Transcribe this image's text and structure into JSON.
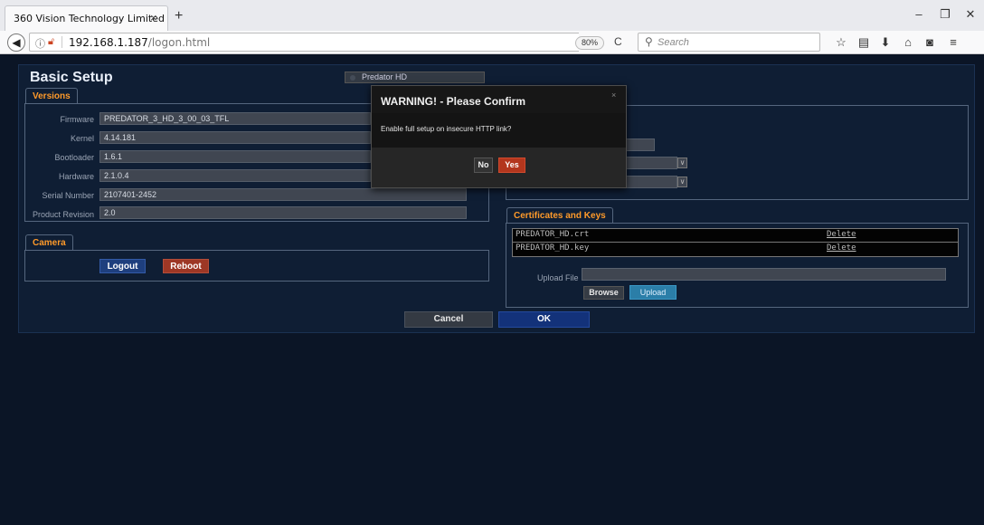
{
  "browser": {
    "tab_title": "360 Vision Technology Limited",
    "tab_close": "×",
    "new_tab": "+",
    "minimize": "–",
    "maximize": "❐",
    "close": "✕",
    "back_icon": "◀",
    "url_host": "192.168.1.187",
    "url_path": "/logon.html",
    "zoom": "80%",
    "reload_icon": "C",
    "search_placeholder": "Search"
  },
  "page": {
    "title": "Basic Setup",
    "device_name": "Predator HD"
  },
  "versions": {
    "tab_label": "Versions",
    "rows": [
      {
        "label": "Firmware",
        "value": "PREDATOR_3_HD_3_00_03_TFL"
      },
      {
        "label": "Kernel",
        "value": "4.14.181"
      },
      {
        "label": "Bootloader",
        "value": "1.6.1"
      },
      {
        "label": "Hardware",
        "value": "2.1.0.4"
      },
      {
        "label": "Serial Number",
        "value": "2107401-2452"
      },
      {
        "label": "Product Revision",
        "value": "2.0"
      }
    ]
  },
  "camera": {
    "tab_label": "Camera",
    "logout_label": "Logout",
    "reboot_label": "Reboot"
  },
  "certificates": {
    "tab_label": "Certificates and Keys",
    "files": [
      {
        "name": "PREDATOR_HD.crt",
        "action": "Delete"
      },
      {
        "name": "PREDATOR_HD.key",
        "action": "Delete"
      }
    ],
    "upload_label": "Upload File",
    "browse_label": "Browse",
    "upload_button": "Upload"
  },
  "footer": {
    "cancel_label": "Cancel",
    "ok_label": "OK"
  },
  "modal": {
    "title": "WARNING! - Please Confirm",
    "close": "×",
    "message": "Enable full setup on insecure HTTP link?",
    "no_label": "No",
    "yes_label": "Yes"
  }
}
